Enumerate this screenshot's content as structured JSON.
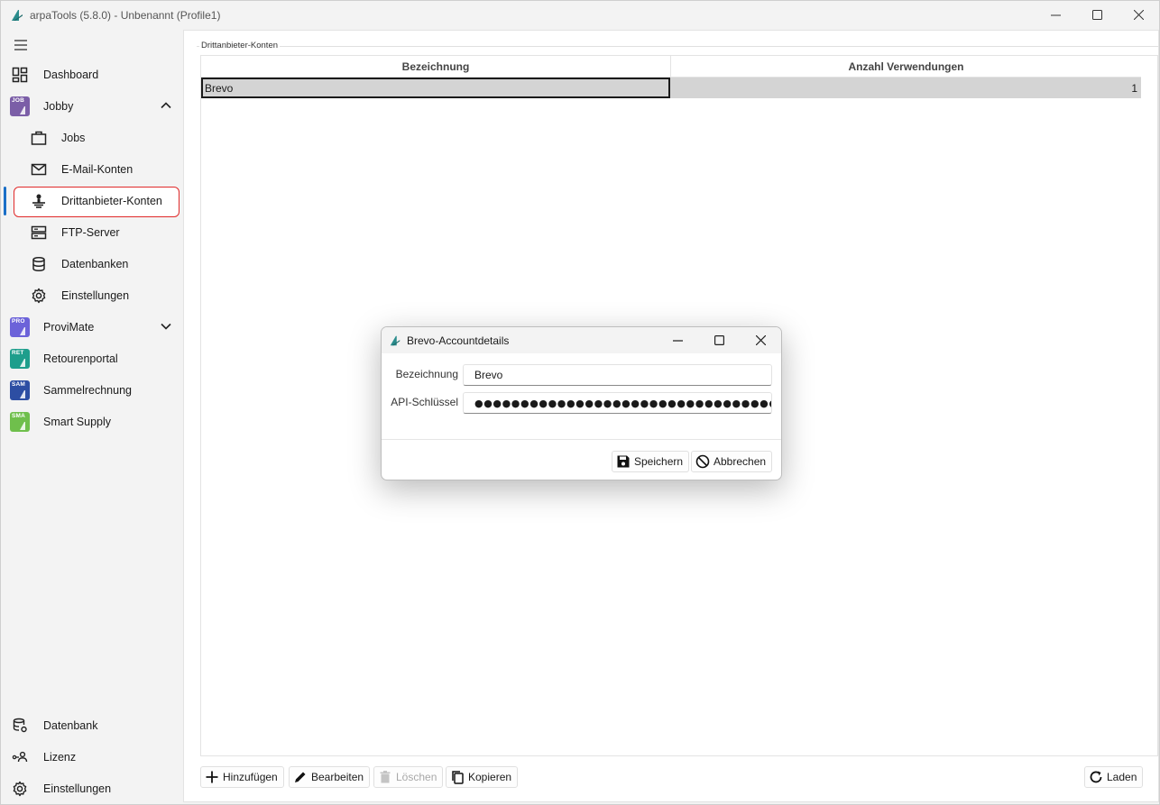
{
  "window": {
    "title": "arpaTools (5.8.0) - Unbenannt (Profile1)"
  },
  "sidebar": {
    "items": [
      {
        "label": "Dashboard"
      },
      {
        "label": "Jobby"
      },
      {
        "label": "Jobs"
      },
      {
        "label": "E-Mail-Konten"
      },
      {
        "label": "Drittanbieter-Konten"
      },
      {
        "label": "FTP-Server"
      },
      {
        "label": "Datenbanken"
      },
      {
        "label": "Einstellungen"
      },
      {
        "label": "ProviMate"
      },
      {
        "label": "Retourenportal"
      },
      {
        "label": "Sammelrechnung"
      },
      {
        "label": "Smart Supply"
      }
    ],
    "bottom": [
      {
        "label": "Datenbank"
      },
      {
        "label": "Lizenz"
      },
      {
        "label": "Einstellungen"
      }
    ],
    "badges": {
      "jobby": "JOB",
      "provimate": "PRO",
      "retourenportal": "RET",
      "sammelrechnung": "SAM",
      "smartsupply": "SMA"
    }
  },
  "main": {
    "group_label": "Drittanbieter-Konten",
    "columns": [
      "Bezeichnung",
      "Anzahl Verwendungen"
    ],
    "rows": [
      {
        "name": "Brevo",
        "count": "1"
      }
    ],
    "toolbar": {
      "add": "Hinzufügen",
      "edit": "Bearbeiten",
      "delete": "Löschen",
      "copy": "Kopieren",
      "reload": "Laden"
    }
  },
  "dialog": {
    "title": "Brevo-Accountdetails",
    "name_label": "Bezeichnung",
    "name_value": "Brevo",
    "api_label": "API-Schlüssel",
    "api_value": "●●●●●●●●●●●●●●●●●●●●●●●●●●●●●●●●●●●●●●●●●●●●●●",
    "save": "Speichern",
    "cancel": "Abbrechen"
  },
  "colors": {
    "accent": "#1a6fc7",
    "highlight": "#e02a2a",
    "selected_row": "#d4d4d4",
    "badge_jobby": "#7b5ea7",
    "badge_provimate": "#6c63d9",
    "badge_retourenportal": "#1e9e8c",
    "badge_sammelrechnung": "#2d4ea3",
    "badge_smartsupply": "#6fbf4c"
  }
}
